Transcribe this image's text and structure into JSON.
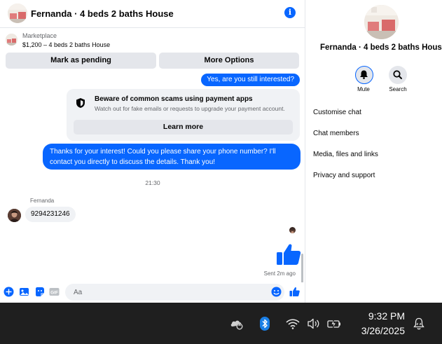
{
  "header": {
    "title": "Fernanda · 4 beds 2 baths House"
  },
  "listing": {
    "source": "Marketplace",
    "price_title": "$1,200 – 4 beds 2 baths House"
  },
  "actions": {
    "pending_label": "Mark as pending",
    "options_label": "More Options"
  },
  "messages": {
    "still_interested": "Yes, are you still interested?",
    "scam_title": "Beware of common scams using payment apps",
    "scam_subtitle": "Watch out for fake emails or requests to upgrade your payment account.",
    "learn_more": "Learn more",
    "thanks": "Thanks for your interest! Could you please share your phone number? I'll contact you directly to discuss the details. Thank you!",
    "timestamp": "21:30",
    "sender_name": "Fernanda",
    "phone": "9294231246",
    "sent_status": "Sent 2m ago"
  },
  "composer": {
    "placeholder": "Aa"
  },
  "info": {
    "title": "Fernanda · 4 beds 2 baths House",
    "mute_label": "Mute",
    "search_label": "Search",
    "links": [
      "Customise chat",
      "Chat members",
      "Media, files and links",
      "Privacy and support"
    ]
  },
  "taskbar": {
    "time": "9:32 PM",
    "date": "3/26/2025"
  },
  "colors": {
    "accent": "#0866ff",
    "bubble_in": "#f0f2f5",
    "taskbar": "#1f1f1f"
  }
}
